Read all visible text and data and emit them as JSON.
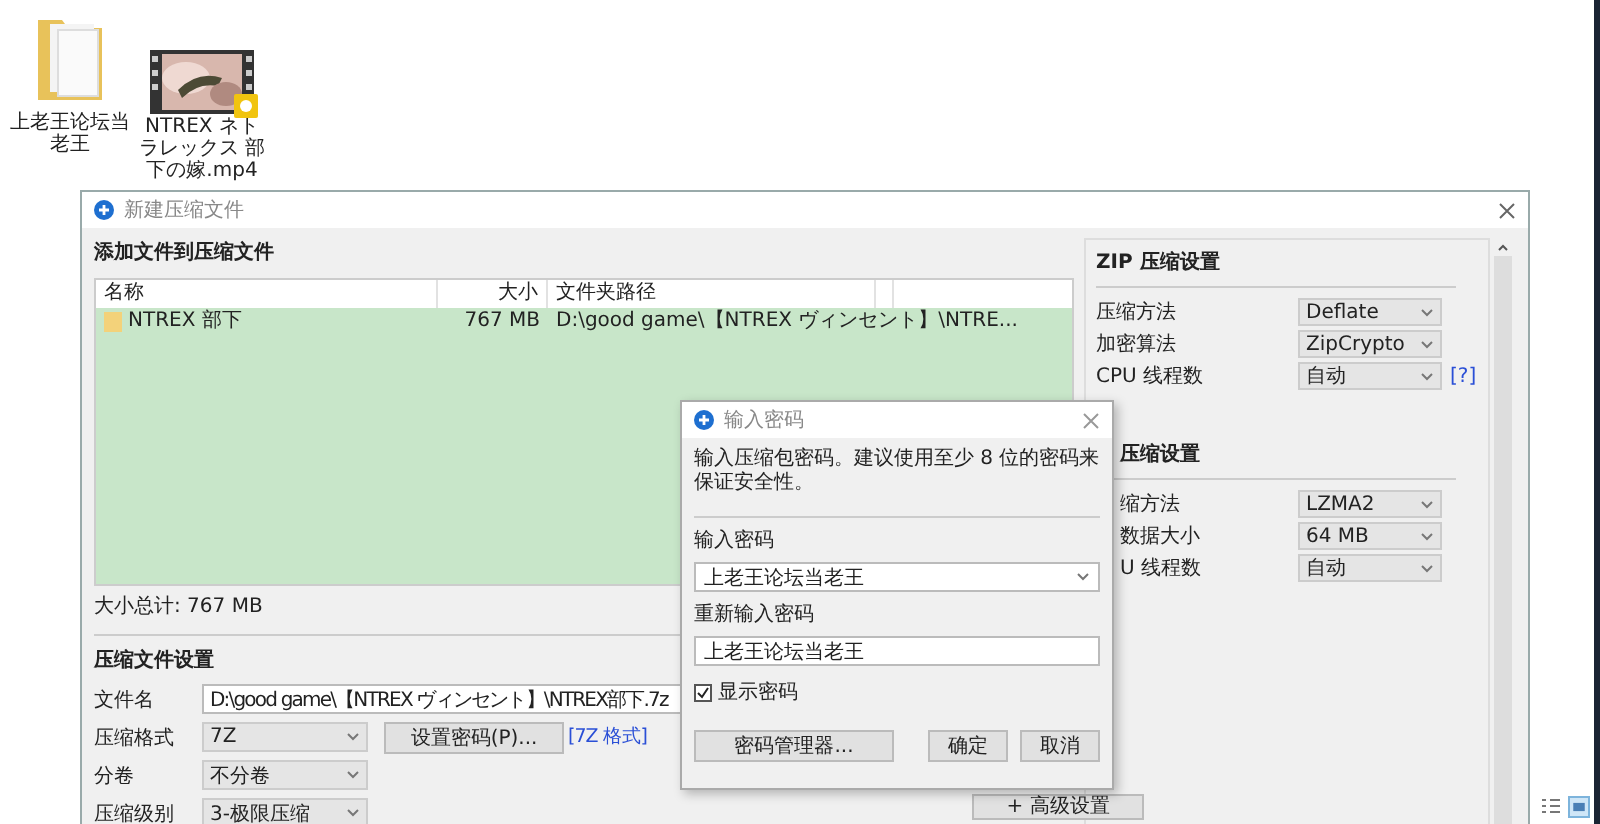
{
  "desktop_icons": [
    {
      "kind": "folder",
      "label": "上老王论坛当老王"
    },
    {
      "kind": "video",
      "label": "NTREX ネトラレックス 部下の嫁.mp4"
    }
  ],
  "main_window": {
    "title": "新建压缩文件",
    "files": {
      "title": "添加文件到压缩文件",
      "columns": [
        "名称",
        "大小",
        "文件夹路径"
      ],
      "rows": [
        {
          "name": "NTREX 部下",
          "size": "767 MB",
          "path": "D:\\good game\\【NTREX ヴィンセント】\\NTRE...",
          "selected": true
        }
      ],
      "total": "大小总计: 767 MB"
    },
    "settings": {
      "title": "压缩文件设置",
      "rows": [
        {
          "kind": "input",
          "label": "文件名",
          "value": "D:\\good game\\【NTREX ヴィンセント】\\NTREX部下.7z"
        },
        {
          "kind": "select",
          "label": "压缩格式",
          "value": "7Z",
          "button": "设置密码(P)...",
          "link": "[7Z 格式]"
        },
        {
          "kind": "select",
          "label": "分卷",
          "value": "不分卷"
        },
        {
          "kind": "select",
          "label": "压缩级别",
          "value": "3-极限压缩"
        }
      ],
      "advanced_button": "+ 高级设置"
    },
    "side_sections": [
      {
        "title": "ZIP 压缩设置",
        "partial": false,
        "rows": [
          {
            "label": "压缩方法",
            "value": "Deflate"
          },
          {
            "label": "加密算法",
            "value": "ZipCrypto"
          },
          {
            "label": "CPU 线程数",
            "value": "自动",
            "help": "[?]"
          }
        ]
      },
      {
        "title": "压缩设置",
        "partial": true,
        "rows": [
          {
            "label": "缩方法",
            "value": "LZMA2"
          },
          {
            "label": "数据大小",
            "value": "64 MB"
          },
          {
            "label": "U 线程数",
            "value": "自动"
          }
        ]
      }
    ]
  },
  "password_dialog": {
    "title": "输入密码",
    "message": "输入压缩包密码。建议使用至少 8 位的密码来保证安全性。",
    "password_label": "输入密码",
    "password": "上老王论坛当老王",
    "repeat_label": "重新输入密码",
    "repeat": "上老王论坛当老王",
    "show_password": {
      "label": "显示密码",
      "checked": true
    },
    "buttons": [
      {
        "kind": "manager",
        "label": "密码管理器..."
      },
      {
        "kind": "ok",
        "label": "确定"
      },
      {
        "kind": "cancel",
        "label": "取消"
      }
    ]
  }
}
